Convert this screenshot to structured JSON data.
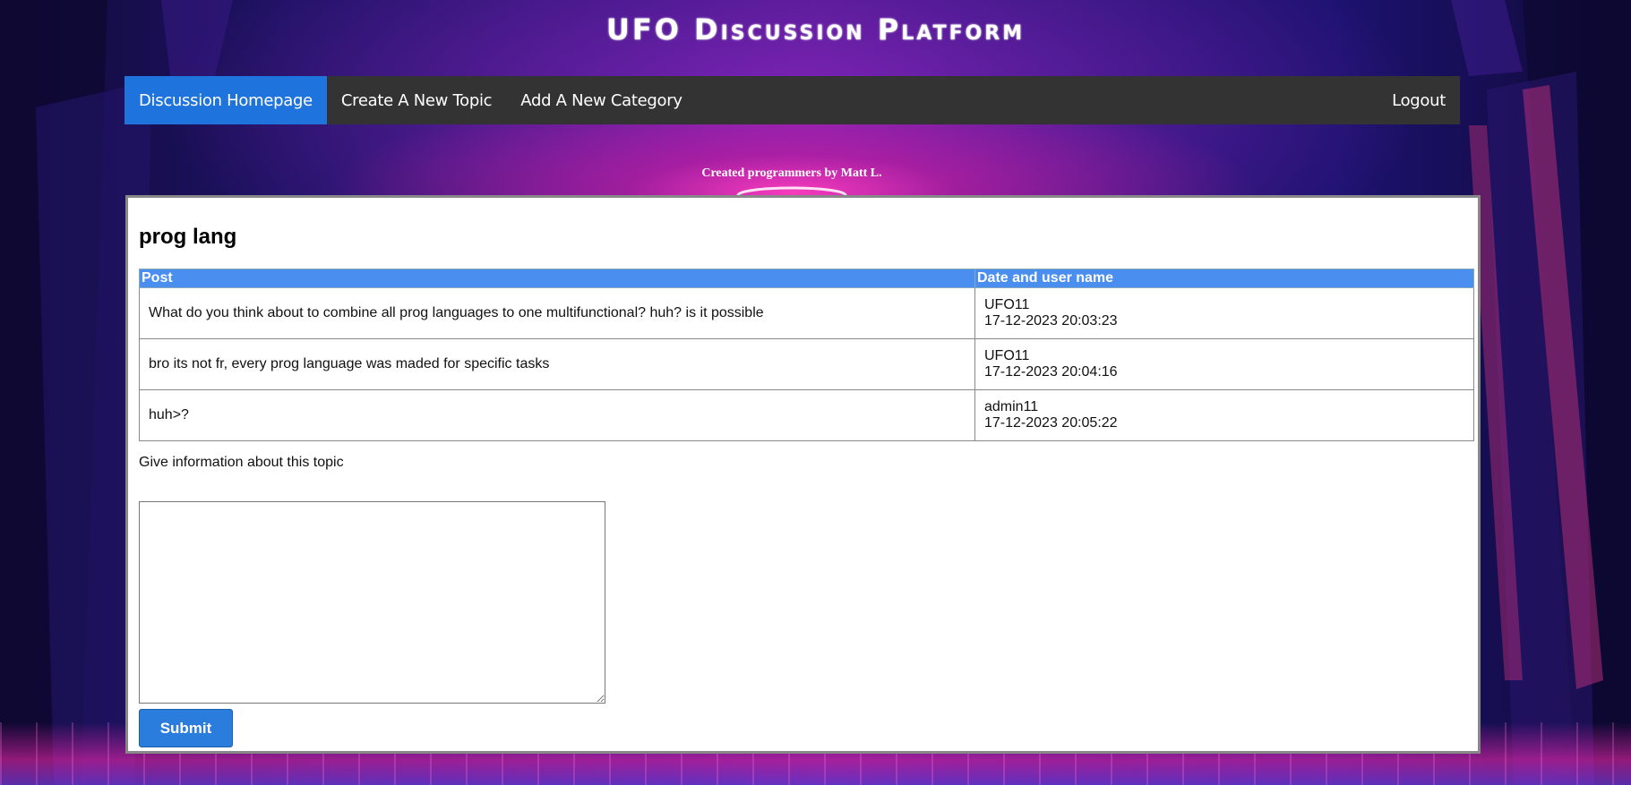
{
  "header": {
    "site_title": "UFO Discussion Platform"
  },
  "nav": {
    "items": [
      {
        "label": "Discussion Homepage",
        "active": true
      },
      {
        "label": "Create A New Topic",
        "active": false
      },
      {
        "label": "Add A New Category",
        "active": false
      }
    ],
    "logout_label": "Logout"
  },
  "credits": "Created programmers by Matt L.",
  "topic": {
    "title": "prog lang",
    "columns": [
      "Post",
      "Date and user name"
    ],
    "posts": [
      {
        "text": "What do you think about to combine all prog languages to one multifunctional? huh? is it possible",
        "user": "UFO11",
        "date": "17-12-2023 20:03:23"
      },
      {
        "text": "bro its not fr, every prog language was maded for specific tasks",
        "user": "UFO11",
        "date": "17-12-2023 20:04:16"
      },
      {
        "text": "huh>?",
        "user": "admin11",
        "date": "17-12-2023 20:05:22"
      }
    ]
  },
  "reply": {
    "prompt": "Give information about this topic",
    "value": "",
    "submit_label": "Submit"
  },
  "colors": {
    "nav_bg": "#333333",
    "nav_active": "#1e73dc",
    "table_header": "#4a8ff0",
    "button": "#2a7ddc"
  }
}
